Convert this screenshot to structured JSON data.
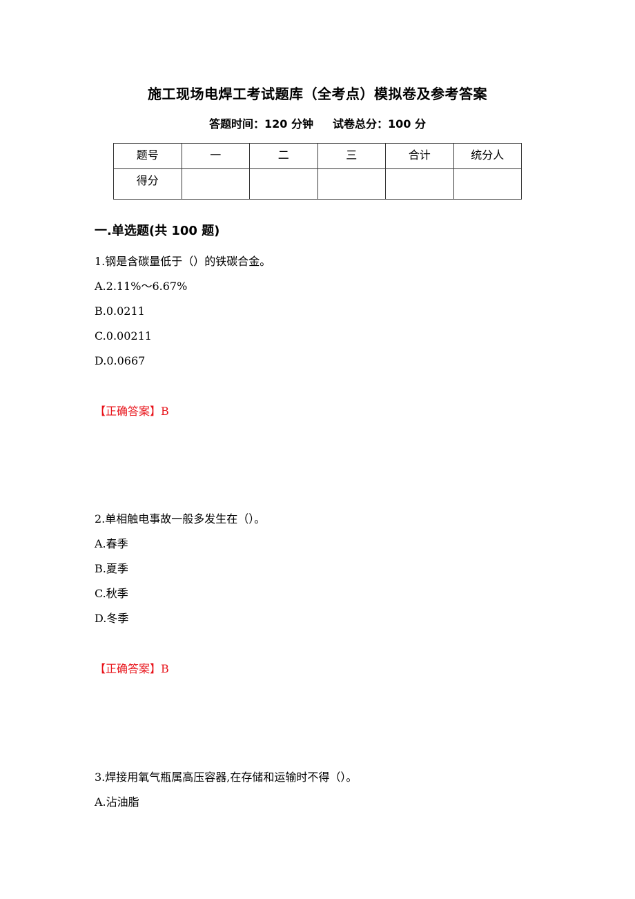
{
  "document": {
    "title": "施工现场电焊工考试题库（全考点）模拟卷及参考答案",
    "exam_time_label": "答题时间：120 分钟",
    "total_score_label": "试卷总分：100 分"
  },
  "score_table": {
    "header": [
      "题号",
      "一",
      "二",
      "三",
      "合计",
      "统分人"
    ],
    "row": [
      "得分",
      "",
      "",
      "",
      "",
      ""
    ]
  },
  "section": {
    "title": "一.单选题(共 100 题)"
  },
  "questions": [
    {
      "stem": "1.钢是含碳量低于（）的铁碳合金。",
      "options": [
        "A.2.11%～6.67%",
        "B.0.0211",
        "C.0.00211",
        "D.0.0667"
      ],
      "answer": "【正确答案】B"
    },
    {
      "stem": "2.单相触电事故一般多发生在（）。",
      "options": [
        "A.春季",
        "B.夏季",
        "C.秋季",
        "D.冬季"
      ],
      "answer": "【正确答案】B"
    },
    {
      "stem": "3.焊接用氧气瓶属高压容器,在存储和运输时不得（）。",
      "options": [
        "A.沾油脂"
      ]
    }
  ],
  "colors": {
    "answer": "#e8141b",
    "text": "#000000"
  }
}
